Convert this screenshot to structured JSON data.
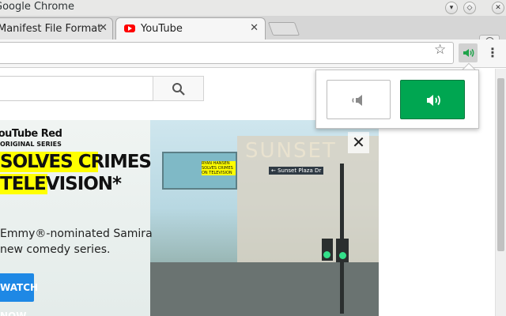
{
  "window": {
    "title": "Google Chrome"
  },
  "tabs": [
    {
      "label": "Manifest File Format",
      "close": "✕"
    },
    {
      "label": "YouTube",
      "close": "✕"
    }
  ],
  "toolbar": {
    "star_icon": "star-icon",
    "menu_glyph": "⋮",
    "extension_icon": "speaker-icon"
  },
  "popup": {
    "mute_icon": "speaker-muted-icon",
    "unmute_icon": "speaker-on-icon",
    "active_color": "#00a651"
  },
  "youtube": {
    "search_icon": "search-icon"
  },
  "ad": {
    "brand": "YouTube Red",
    "series": "ORIGINAL SERIES",
    "headline_1": "SOLVES CRIMES",
    "headline_2": "TELEVISION*",
    "desc_1": "Emmy®-nominated Samira",
    "desc_2": "new comedy series.",
    "cta": "WATCH NOW",
    "close": "✕",
    "sign": "← Sunset Plaza Dr",
    "building": "SUNSET",
    "billboard": "RYAN HANSEN SOLVES CRIMES ON TELEVISION"
  }
}
